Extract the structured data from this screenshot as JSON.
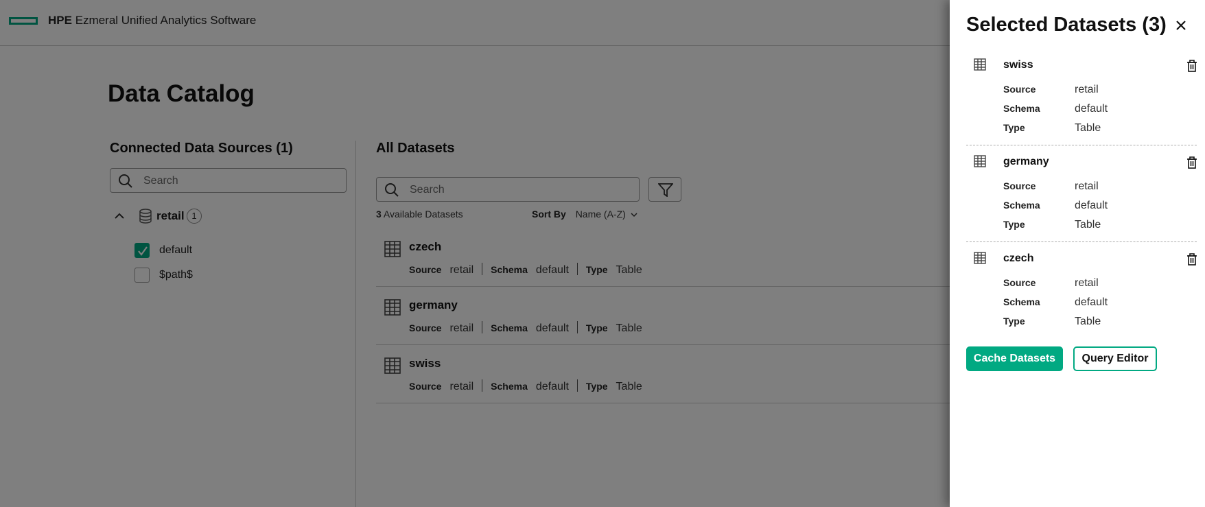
{
  "header": {
    "brand_bold": "HPE",
    "brand_rest": "Ezmeral Unified Analytics Software"
  },
  "page_title": "Data Catalog",
  "left_panel": {
    "title": "Connected Data Sources (1)",
    "search_placeholder": "Search",
    "source": {
      "name": "retail",
      "count": "1",
      "expanded": true,
      "schemas": [
        {
          "label": "default",
          "checked": true
        },
        {
          "label": "$path$",
          "checked": false
        }
      ]
    }
  },
  "main": {
    "title": "All Datasets",
    "search_placeholder": "Search",
    "available_count": "3",
    "available_label": "Available Datasets",
    "sort_label": "Sort By",
    "sort_value": "Name (A-Z)",
    "datasets": [
      {
        "name": "czech",
        "source_label": "Source",
        "source": "retail",
        "schema_label": "Schema",
        "schema": "default",
        "type_label": "Type",
        "type": "Table"
      },
      {
        "name": "germany",
        "source_label": "Source",
        "source": "retail",
        "schema_label": "Schema",
        "schema": "default",
        "type_label": "Type",
        "type": "Table"
      },
      {
        "name": "swiss",
        "source_label": "Source",
        "source": "retail",
        "schema_label": "Schema",
        "schema": "default",
        "type_label": "Type",
        "type": "Table"
      }
    ]
  },
  "drawer": {
    "title": "Selected Datasets (3)",
    "items": [
      {
        "name": "swiss",
        "source_label": "Source",
        "source": "retail",
        "schema_label": "Schema",
        "schema": "default",
        "type_label": "Type",
        "type": "Table"
      },
      {
        "name": "germany",
        "source_label": "Source",
        "source": "retail",
        "schema_label": "Schema",
        "schema": "default",
        "type_label": "Type",
        "type": "Table"
      },
      {
        "name": "czech",
        "source_label": "Source",
        "source": "retail",
        "schema_label": "Schema",
        "schema": "default",
        "type_label": "Type",
        "type": "Table"
      }
    ],
    "cache_button": "Cache Datasets",
    "query_button": "Query Editor"
  },
  "icons": {
    "brand_logo": "hpe-element-logo",
    "search": "search-icon",
    "filter": "filter-icon",
    "chevron_up": "chevron-up-icon",
    "chevron_down": "chevron-down-icon",
    "database": "database-icon",
    "table": "table-icon",
    "close": "close-icon",
    "trash": "trash-icon",
    "checkmark": "checkmark-icon"
  },
  "colors": {
    "accent": "#01a982",
    "overlay": "rgba(0,0,0,0.5)"
  }
}
